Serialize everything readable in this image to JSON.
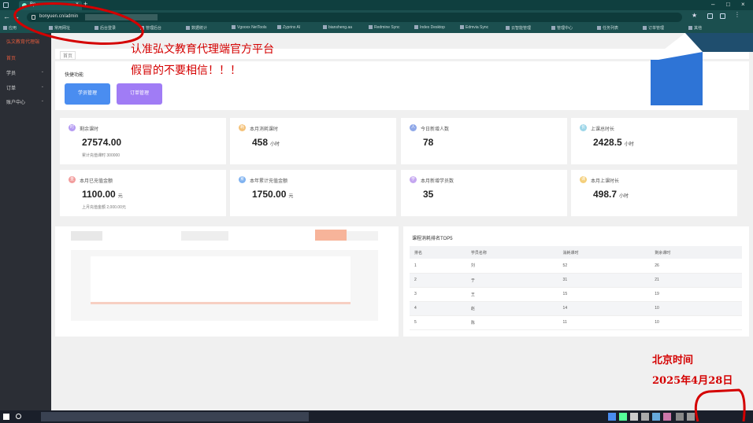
{
  "browser": {
    "tab_title": "Bp",
    "url_prefix": "bonyuen.cn/admin",
    "bookmarks": [
      "应用",
      "常用网址",
      "后台登录",
      "管理后台",
      "数据统计",
      "Vgooxx NetTools",
      "Zyprinx AI",
      "biansheng.aa",
      "Redmine Sync",
      "Index Desktop",
      "Edmvia Sync",
      "云智能管理",
      "管理中心",
      "任务列表",
      "订单管理",
      "其他"
    ]
  },
  "sidebar": {
    "logo": "弘文教育代理端",
    "items": [
      {
        "label": "首页",
        "active": true
      },
      {
        "label": "学员",
        "active": false
      },
      {
        "label": "订单",
        "active": false
      },
      {
        "label": "账户中心",
        "active": false
      }
    ]
  },
  "breadcrumb": "首页",
  "quick": {
    "title": "快捷功能",
    "buttons": [
      "学员管理",
      "订单管理"
    ]
  },
  "cards": [
    {
      "label": "剩余课时",
      "value": "27574.00",
      "unit": "",
      "sub": "累计充值课时 300000",
      "icon_color": "#b59bf2",
      "icon": "时"
    },
    {
      "label": "本月消耗课时",
      "value": "458",
      "unit": "小时",
      "sub": "",
      "icon_color": "#f4c27a",
      "icon": "耗"
    },
    {
      "label": "今日新增人数",
      "value": "78",
      "unit": "",
      "sub": "",
      "icon_color": "#8fa8e8",
      "icon": "人"
    },
    {
      "label": "上课总时长",
      "value": "2428.5",
      "unit": "小时",
      "sub": "",
      "icon_color": "#9dd6e8",
      "icon": "长"
    },
    {
      "label": "本月已充值金额",
      "value": "1100.00",
      "unit": "元",
      "sub": "上月充值金额 2,000.00元",
      "icon_color": "#f29c9c",
      "icon": "金"
    },
    {
      "label": "本年累计充值金额",
      "value": "1750.00",
      "unit": "元",
      "sub": "",
      "icon_color": "#7fb2f0",
      "icon": "累"
    },
    {
      "label": "本月新增学员数",
      "value": "35",
      "unit": "",
      "sub": "",
      "icon_color": "#c4a6f0",
      "icon": "学"
    },
    {
      "label": "本月上课时长",
      "value": "498.7",
      "unit": "小时",
      "sub": "",
      "icon_color": "#f4cf7a",
      "icon": "课"
    }
  ],
  "tops": {
    "title": "课程消耗排名TOP5",
    "headers": [
      "排名",
      "学员名称",
      "消耗课时",
      "剩余课时"
    ],
    "rows": [
      [
        "1",
        "刘",
        "52",
        "26"
      ],
      [
        "2",
        "于",
        "31",
        "21"
      ],
      [
        "3",
        "王",
        "15",
        "19"
      ],
      [
        "4",
        "赵",
        "14",
        "10"
      ],
      [
        "5",
        "陈",
        "11",
        "10"
      ]
    ]
  },
  "annotations": {
    "line1": "认准弘文教育代理端官方平台",
    "line2": "假冒的不要相信！！！",
    "time_label": "北京时间",
    "date_label": "2025年4月28日"
  },
  "colors": {
    "accent_red": "#d40000",
    "sidebar_bg": "#2b2e35",
    "primary_blue": "#4a8df0",
    "primary_purple": "#a07cf5"
  }
}
